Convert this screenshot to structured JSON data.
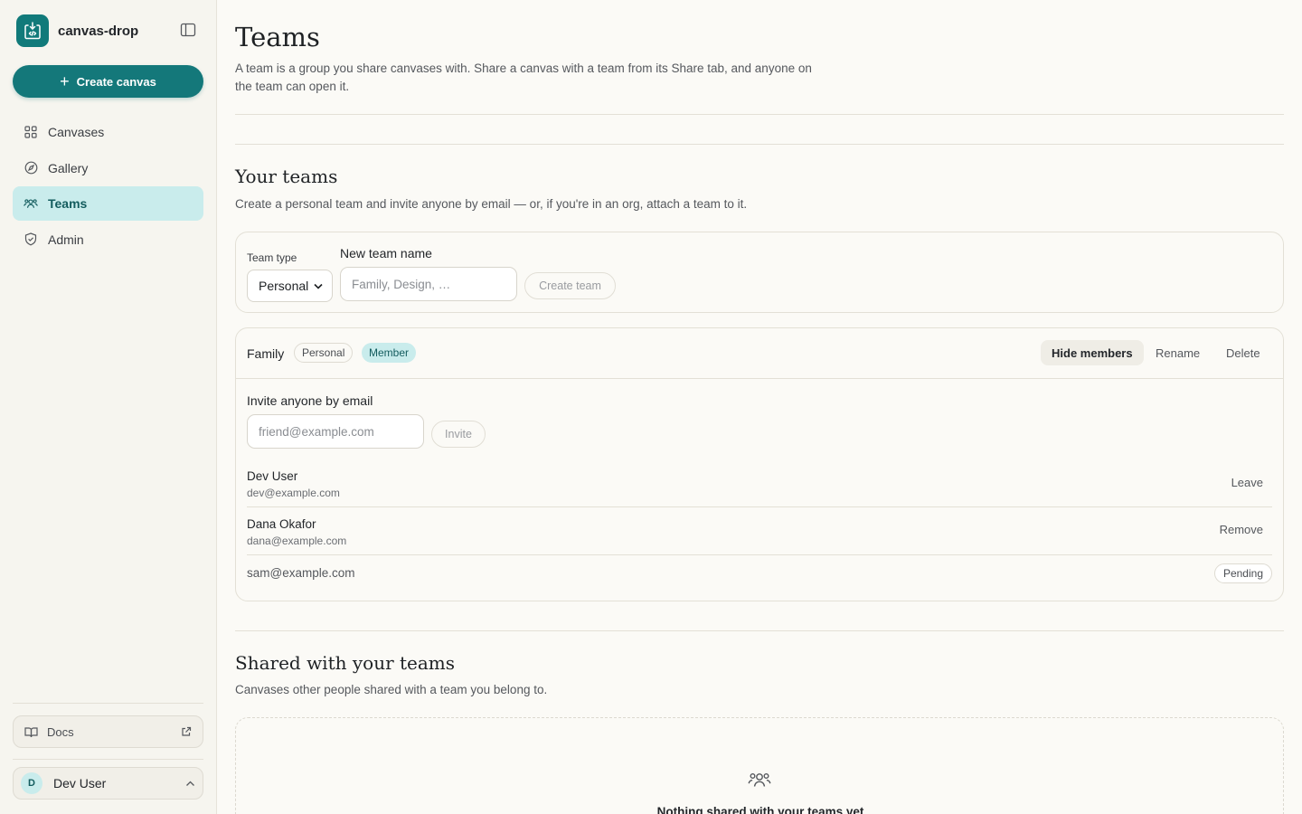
{
  "app": {
    "name": "canvas-drop",
    "create_label": "Create canvas",
    "accent": "#14787a"
  },
  "sidebar": {
    "items": [
      {
        "label": "Canvases",
        "icon": "grid-icon"
      },
      {
        "label": "Gallery",
        "icon": "compass-icon"
      },
      {
        "label": "Teams",
        "icon": "users-icon",
        "active": true
      },
      {
        "label": "Admin",
        "icon": "shield-check-icon"
      }
    ],
    "docs_label": "Docs",
    "user": {
      "initial": "D",
      "name": "Dev User"
    }
  },
  "page": {
    "title": "Teams",
    "description": "A team is a group you share canvases with. Share a canvas with a team from its Share tab, and anyone on the team can open it."
  },
  "your_teams": {
    "title": "Your teams",
    "description": "Create a personal team and invite anyone by email — or, if you're in an org, attach a team to it.",
    "form": {
      "type_label": "Team type",
      "type_value": "Personal",
      "name_label": "New team name",
      "name_placeholder": "Family, Design, …",
      "create_label": "Create team"
    }
  },
  "team": {
    "name": "Family",
    "type_badge": "Personal",
    "role_badge": "Member",
    "actions": {
      "hide_members": "Hide members",
      "rename": "Rename",
      "delete": "Delete"
    },
    "invite": {
      "label": "Invite anyone by email",
      "placeholder": "friend@example.com",
      "button": "Invite"
    },
    "members": [
      {
        "name": "Dev User",
        "email": "dev@example.com",
        "action": "Leave"
      },
      {
        "name": "Dana Okafor",
        "email": "dana@example.com",
        "action": "Remove"
      }
    ],
    "pending": {
      "email": "sam@example.com",
      "status": "Pending"
    }
  },
  "shared": {
    "title": "Shared with your teams",
    "description": "Canvases other people shared with a team you belong to.",
    "empty_text": "Nothing shared with your teams yet"
  }
}
